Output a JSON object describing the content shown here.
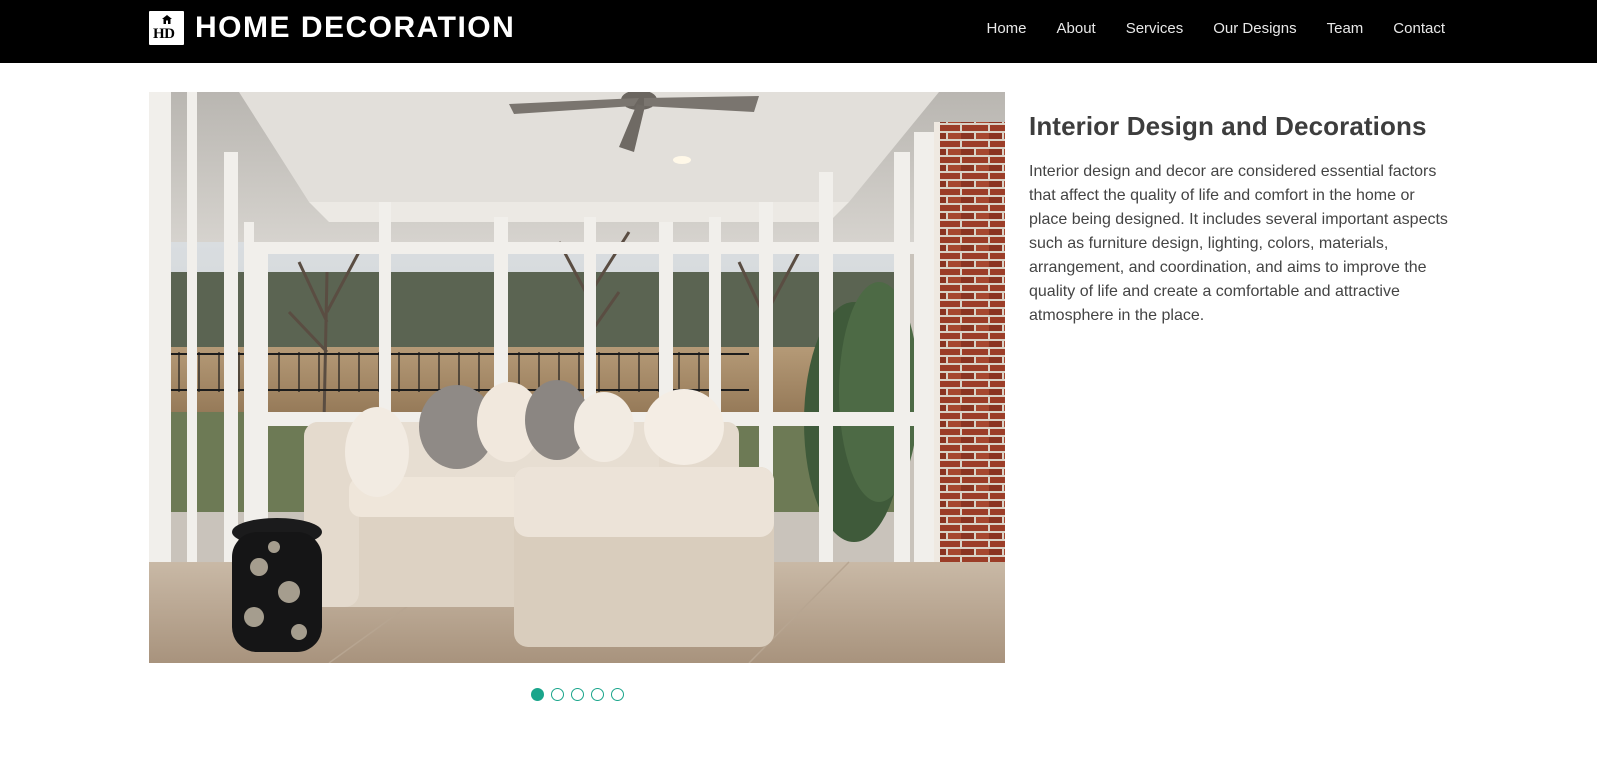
{
  "brand": {
    "logo_text": "HD",
    "name": "HOME DECORATION",
    "logo_icon": "house-icon"
  },
  "nav": {
    "items": [
      {
        "label": "Home"
      },
      {
        "label": "About"
      },
      {
        "label": "Services"
      },
      {
        "label": "Our Designs"
      },
      {
        "label": "Team"
      },
      {
        "label": "Contact"
      }
    ]
  },
  "hero": {
    "image_subject": "sunroom-living-room-photo",
    "active_slide": 1,
    "slide_count": 5
  },
  "content": {
    "title": "Interior Design and Decorations",
    "body": "Interior design and decor are considered essential factors that affect the quality of life and comfort in the home or place being designed. It includes several important aspects such as furniture design, lighting, colors, materials, arrangement, and coordination, and aims to improve the quality of life and create a comfortable and attractive atmosphere in the place."
  },
  "colors": {
    "navbar_bg": "#000000",
    "accent": "#1aa58b",
    "text": "#3d3d3d"
  }
}
